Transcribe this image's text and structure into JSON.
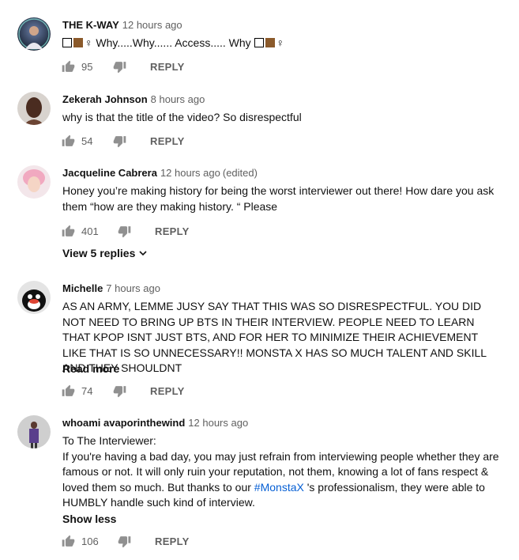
{
  "comments": [
    {
      "author": "THE K-WAY",
      "time": "12 hours ago",
      "text_parts": [
        "♀ Why.....Why...... Access..... Why",
        "♀"
      ],
      "likes": "95",
      "reply": "REPLY"
    },
    {
      "author": "Zekerah Johnson",
      "time": "8 hours ago",
      "text": "why is that the title of the video? So disrespectful",
      "likes": "54",
      "reply": "REPLY"
    },
    {
      "author": "Jacqueline Cabrera",
      "time": "12 hours ago",
      "edited": "(edited)",
      "text": "Honey you’re making history for being the worst interviewer out there! How dare you ask them “how are they making history. “ Please",
      "likes": "401",
      "reply": "REPLY",
      "view_replies": "View 5 replies"
    },
    {
      "author": "Michelle",
      "time": "7 hours ago",
      "text": "AS AN ARMY, LEMME JUSY SAY THAT THIS WAS SO DISRESPECTFUL. YOU DID NOT NEED TO BRING UP BTS IN THEIR INTERVIEW.  PEOPLE NEED TO LEARN THAT KPOP ISNT JUST BTS, AND FOR HER TO MINIMIZE THEIR ACHIEVEMENT LIKE THAT IS SO UNNECESSARY!! MONSTA X HAS SO MUCH TALENT AND SKILL AND THEY SHOULDNT",
      "read_more": "Read more",
      "likes": "74",
      "reply": "REPLY"
    },
    {
      "author": "whoami avaporinthewind",
      "time": "12 hours ago",
      "text_line1": "To The Interviewer:",
      "text_line2a": "If you're having a bad day, you may just refrain from interviewing people whether they are famous or not. It will only ruin your reputation, not them, knowing a lot of fans respect & loved them so much. But thanks to our ",
      "hashtag": "#MonstaX",
      "text_line2b": " 's professionalism, they were able to HUMBLY handle such kind of interview.",
      "show_less": "Show less",
      "likes": "106",
      "reply": "REPLY"
    }
  ]
}
